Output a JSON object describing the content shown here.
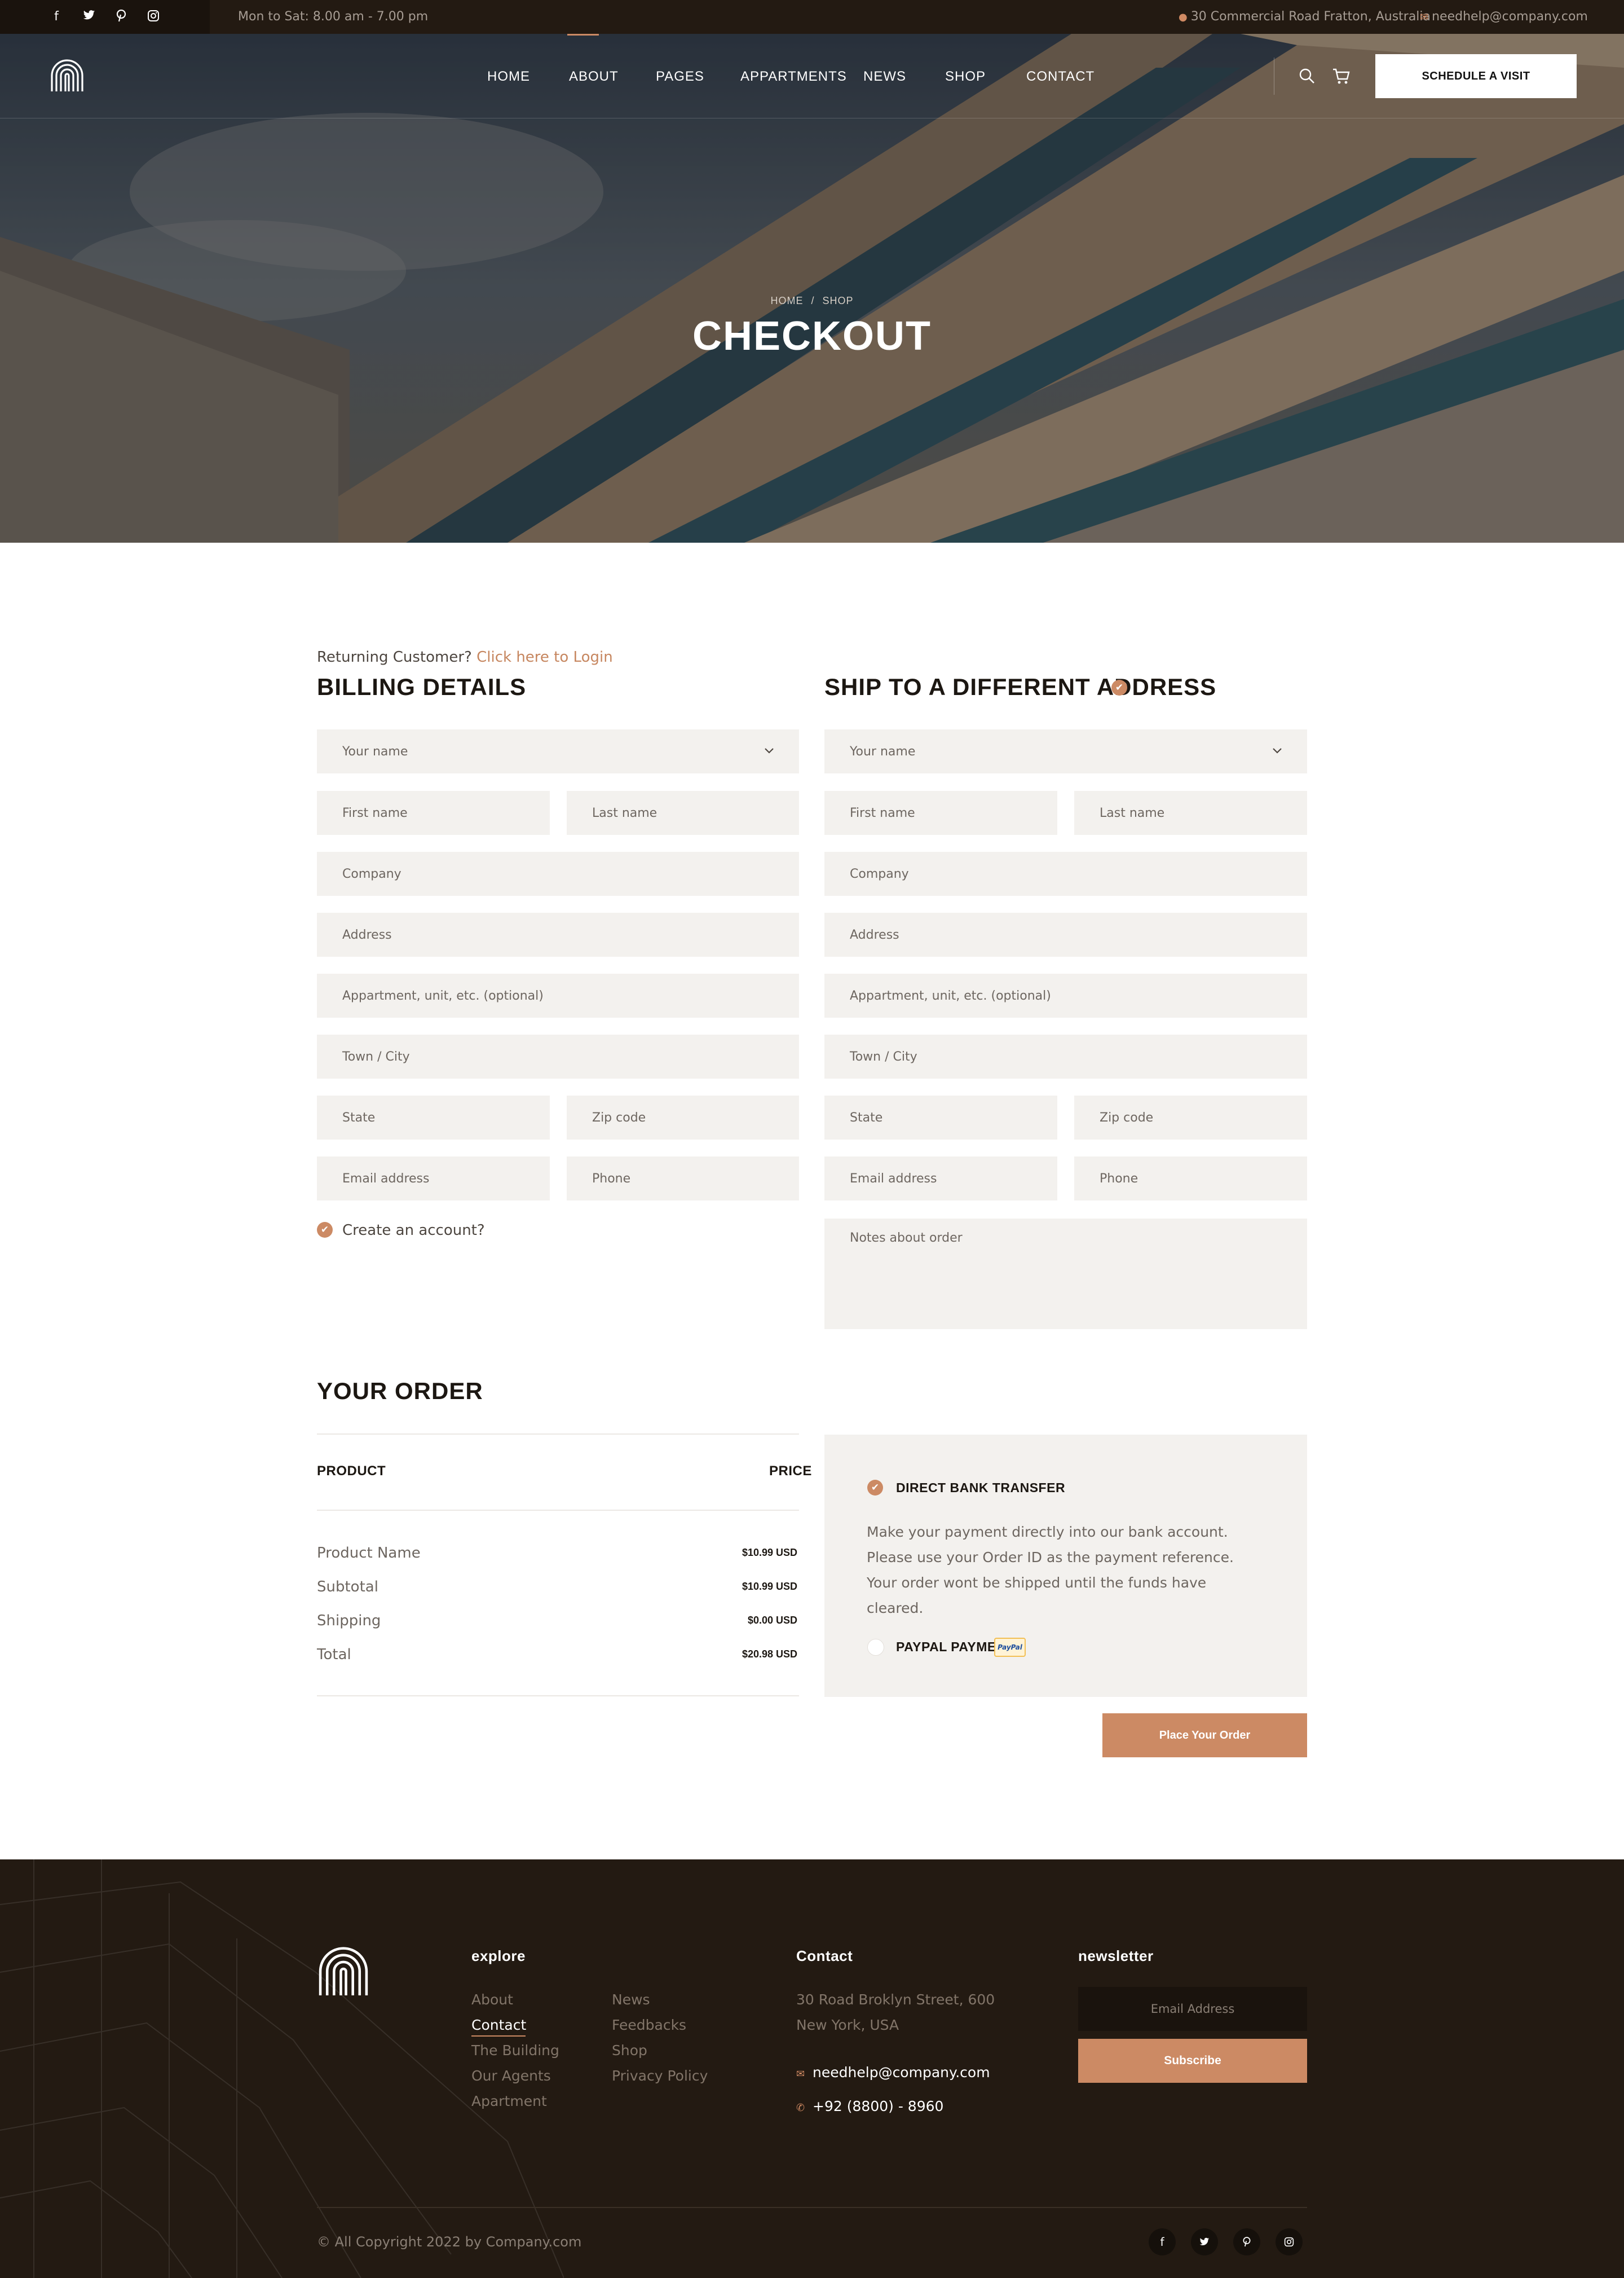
{
  "topbar": {
    "hours": "Mon to Sat: 8.00 am - 7.00 pm",
    "address": "30 Commercial Road Fratton, Australia",
    "email": "needhelp@company.com",
    "social_icons": [
      "facebook-icon",
      "twitter-icon",
      "pinterest-icon",
      "instagram-icon"
    ]
  },
  "nav": {
    "items": [
      "HOME",
      "ABOUT",
      "PAGES",
      "APPARTMENTS",
      "NEWS",
      "SHOP",
      "CONTACT"
    ],
    "cta": "SCHEDULE A VISIT"
  },
  "hero": {
    "crumb_home": "HOME",
    "crumb_sep": "/",
    "crumb_current": "SHOP",
    "title": "CHECKOUT"
  },
  "checkout": {
    "returning_text": "Returning Customer?",
    "returning_link": "Click here to Login",
    "billing_title": "BILLING DETAILS",
    "shipping_title": "SHIP TO A DIFFERENT ADDRESS",
    "fields": {
      "your_name": "Your name",
      "first_name": "First name",
      "last_name": "Last name",
      "company": "Company",
      "address": "Address",
      "apartment": "Appartment, unit, etc. (optional)",
      "city": "Town / City",
      "state": "State",
      "zip": "Zip code",
      "email": "Email address",
      "phone": "Phone",
      "notes": "Notes about order"
    },
    "create_account": "Create an account?"
  },
  "order": {
    "title": "YOUR ORDER",
    "col_product": "PRODUCT",
    "col_price": "PRICE",
    "rows": [
      {
        "label": "Product Name",
        "value": "$10.99 USD"
      },
      {
        "label": "Subtotal",
        "value": "$10.99 USD"
      },
      {
        "label": "Shipping",
        "value": "$0.00 USD"
      },
      {
        "label": "Total",
        "value": "$20.98 USD"
      }
    ],
    "bank_label": "DIRECT BANK TRANSFER",
    "bank_desc": "Make your payment directly into our bank account. Please use your Order ID as the payment reference. Your order wont be shipped until the funds have cleared.",
    "paypal_label": "PAYPAL PAYMENT",
    "paypal_logo": "PayPal",
    "place_order": "Place Your Order"
  },
  "footer": {
    "explore_title": "explore",
    "explore_col1": [
      "About",
      "Contact",
      "The Building",
      "Our Agents",
      "Apartment"
    ],
    "explore_col2": [
      "News",
      "Feedbacks",
      "Shop",
      "Privacy Policy"
    ],
    "contact_title": "Contact",
    "contact_address_1": "30 Road Broklyn Street, 600",
    "contact_address_2": "New York, USA",
    "contact_email": "needhelp@company.com",
    "contact_phone": "+92 (8800) - 8960",
    "newsletter_title": "newsletter",
    "newsletter_placeholder": "Email Address",
    "newsletter_button": "Subscribe",
    "copyright": "© All Copyright 2022 by Company.com"
  },
  "colors": {
    "accent": "#cc8a64",
    "dark": "#231a12",
    "field_bg": "#f3f1ee"
  }
}
